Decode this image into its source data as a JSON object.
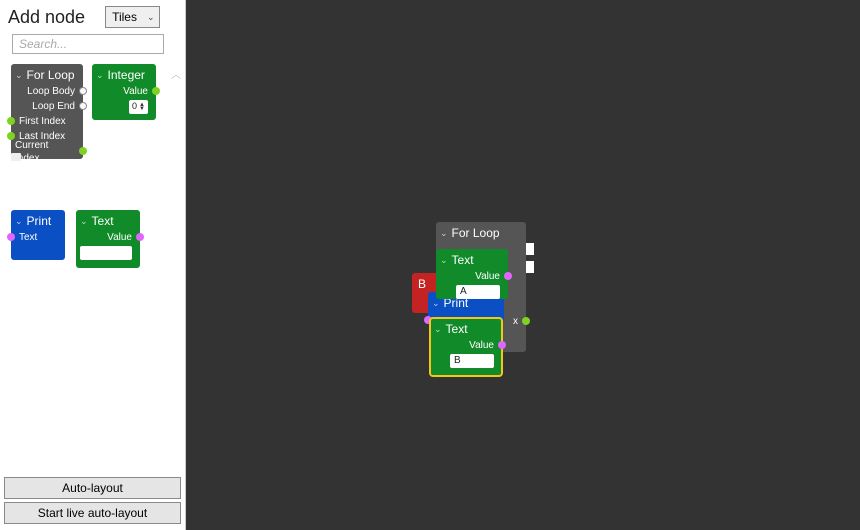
{
  "sidebar": {
    "title": "Add node",
    "view_label": "Tiles",
    "search_placeholder": "Search...",
    "auto_layout": "Auto-layout",
    "live_auto_layout": "Start live auto-layout"
  },
  "palette": {
    "for_loop": {
      "title": "For Loop",
      "loop_body": "Loop Body",
      "loop_end": "Loop End",
      "first_index": "First Index",
      "last_index": "Last Index",
      "current_index": "Current Index"
    },
    "integer": {
      "title": "Integer",
      "value_label": "Value",
      "value": "0"
    },
    "print": {
      "title": "Print",
      "text_label": "Text"
    },
    "text": {
      "title": "Text",
      "value_label": "Value",
      "value": ""
    }
  },
  "canvas": {
    "for_loop": {
      "title": "For Loop"
    },
    "text_a": {
      "title": "Text",
      "value_label": "Value",
      "value": "A"
    },
    "print": {
      "title": "Print"
    },
    "text_b": {
      "title": "Text",
      "value_label": "Value",
      "value": "B"
    },
    "hidden_red_label": "B",
    "index_suffix": "x"
  },
  "colors": {
    "canvas_bg": "#333333",
    "node_grey": "#555555",
    "node_green": "#118a2a",
    "node_blue": "#0b4fc4",
    "node_red": "#c42323",
    "selection": "#f5c518"
  }
}
